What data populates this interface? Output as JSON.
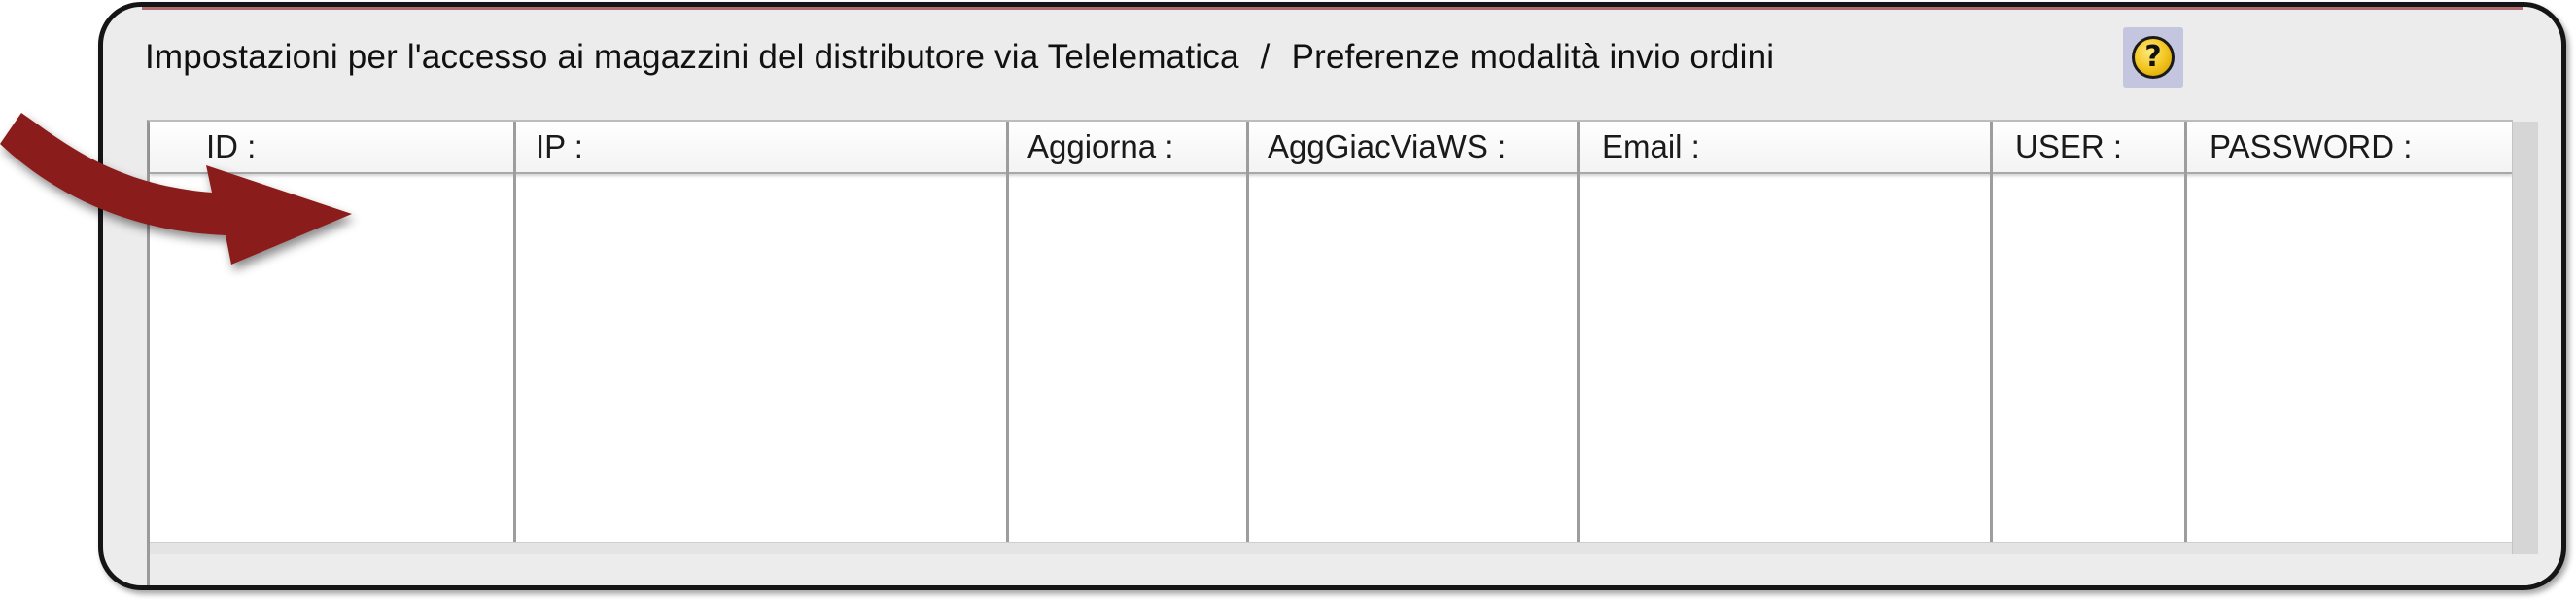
{
  "panel": {
    "title_left": "Impostazioni per l'accesso ai magazzini del distributore via Telelematica",
    "title_separator": "/",
    "title_right": "Preferenze modalità invio ordini",
    "help_icon": "question-mark-icon",
    "help_glyph": "?"
  },
  "table": {
    "columns": [
      {
        "key": "id",
        "label": "ID :"
      },
      {
        "key": "ip",
        "label": "IP :"
      },
      {
        "key": "aggiorna",
        "label": "Aggiorna :"
      },
      {
        "key": "agggiacviaws",
        "label": "AggGiacViaWS :"
      },
      {
        "key": "email",
        "label": "Email :"
      },
      {
        "key": "user",
        "label": "USER :"
      },
      {
        "key": "password",
        "label": "PASSWORD :"
      }
    ],
    "rows": []
  },
  "annotation": {
    "arrow_icon": "curved-arrow-icon",
    "arrow_color": "#8b1a1a"
  },
  "colors": {
    "frame_border": "#151515",
    "panel_bg": "#ececec",
    "help_button_bg": "#c4c5df",
    "help_circle": "#f1c21a"
  }
}
